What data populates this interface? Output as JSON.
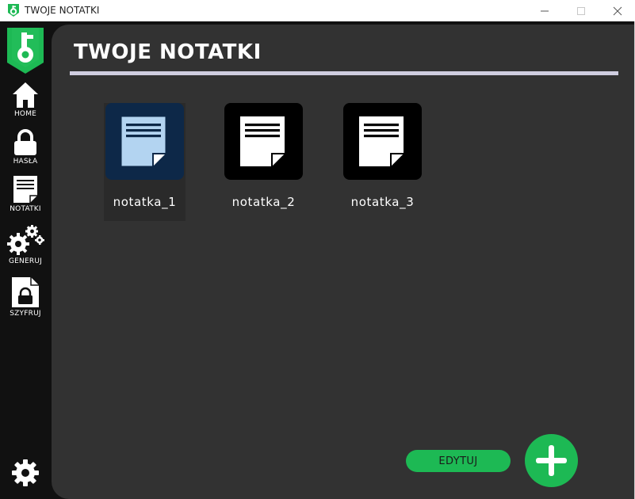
{
  "window": {
    "title": "TWOJE NOTATKI",
    "controls": [
      "minimize",
      "maximize",
      "close"
    ]
  },
  "sidebar": {
    "logo": "key-shield-logo",
    "items": [
      {
        "label": "HOME",
        "icon": "home-icon"
      },
      {
        "label": "HASŁA",
        "icon": "lock-icon"
      },
      {
        "label": "NOTATKI",
        "icon": "note-icon"
      },
      {
        "label": "GENERUJ",
        "icon": "gears-icon"
      },
      {
        "label": "SZYFRUJ",
        "icon": "lock-file-icon"
      }
    ],
    "settings_icon": "gear-icon"
  },
  "main": {
    "title": "TWOJE NOTATKI",
    "notes": [
      {
        "name": "notatka_1",
        "selected": true
      },
      {
        "name": "notatka_2",
        "selected": false
      },
      {
        "name": "notatka_3",
        "selected": false
      }
    ],
    "edit_label": "EDYTUJ",
    "add_icon": "plus-icon"
  },
  "colors": {
    "accent": "#1db954",
    "panel": "#323232",
    "sidebar": "#111111",
    "selected_tile": "#0d2848",
    "selected_doc": "#b3d4f1",
    "rule": "#cfcde0"
  }
}
